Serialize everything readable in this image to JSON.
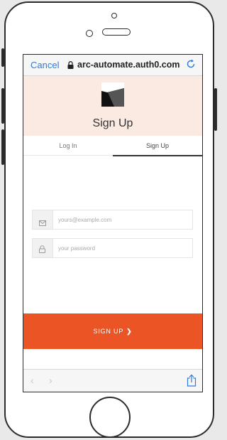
{
  "browser": {
    "cancel_label": "Cancel",
    "url": "arc-automate.auth0.com",
    "lock_icon": "lock-icon",
    "refresh_icon": "refresh-icon"
  },
  "auth": {
    "title": "Sign Up",
    "tabs": [
      {
        "label": "Log In",
        "active": false
      },
      {
        "label": "Sign Up",
        "active": true
      }
    ],
    "email_placeholder": "yours@example.com",
    "password_placeholder": "your password",
    "email_icon": "envelope-icon",
    "password_icon": "lock-icon",
    "submit_label": "SIGN UP",
    "submit_icon": "chevron-right-icon",
    "accent_color": "#eb5424",
    "header_bg": "#fbeae2"
  },
  "toolbar": {
    "back_icon": "chevron-left-icon",
    "forward_icon": "chevron-right-icon",
    "share_icon": "share-icon"
  },
  "colors": {
    "link": "#2f7bdc",
    "device_frame": "#2b2b2b"
  }
}
